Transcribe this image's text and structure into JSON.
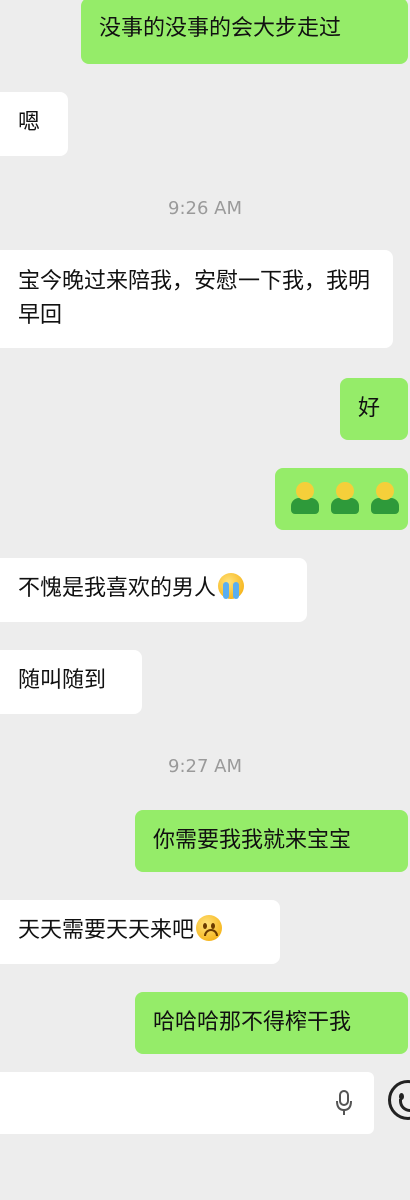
{
  "messages": [
    {
      "text": "没事的没事的会大步走过"
    },
    {
      "text": "嗯"
    },
    {
      "time": "9:26 AM"
    },
    {
      "text": "宝今晚过来陪我，安慰一下我，我明早回"
    },
    {
      "text": "好"
    },
    {
      "sticker": "three-green-figures-sticker"
    },
    {
      "text": "不愧是我喜欢的男人",
      "emoji": "loudly-crying-face"
    },
    {
      "text": "随叫随到"
    },
    {
      "time": "9:27 AM"
    },
    {
      "text": "你需要我我就来宝宝"
    },
    {
      "text": "天天需要天天来吧",
      "emoji": "frowning-face"
    },
    {
      "text": "哈哈哈那不得榨干我"
    }
  ],
  "input": {
    "value": "",
    "mic_icon": "microphone-icon",
    "emoji_icon": "smiley-face-icon"
  }
}
